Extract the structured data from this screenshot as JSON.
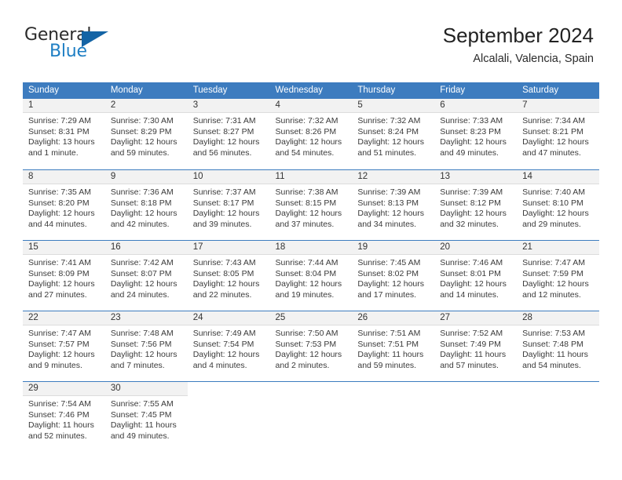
{
  "brand": {
    "name_top": "General",
    "name_bottom": "Blue",
    "accent_color": "#1464a5",
    "blue_text_color": "#1f7fc4"
  },
  "header": {
    "title": "September 2024",
    "location": "Alcalali, Valencia, Spain"
  },
  "calendar": {
    "header_bg": "#3d7cbf",
    "daynum_band_bg": "#f2f2f2",
    "weekdays": [
      "Sunday",
      "Monday",
      "Tuesday",
      "Wednesday",
      "Thursday",
      "Friday",
      "Saturday"
    ],
    "weeks": [
      [
        {
          "day": "1",
          "sunrise": "Sunrise: 7:29 AM",
          "sunset": "Sunset: 8:31 PM",
          "daylight_line1": "Daylight: 13 hours",
          "daylight_line2": "and 1 minute."
        },
        {
          "day": "2",
          "sunrise": "Sunrise: 7:30 AM",
          "sunset": "Sunset: 8:29 PM",
          "daylight_line1": "Daylight: 12 hours",
          "daylight_line2": "and 59 minutes."
        },
        {
          "day": "3",
          "sunrise": "Sunrise: 7:31 AM",
          "sunset": "Sunset: 8:27 PM",
          "daylight_line1": "Daylight: 12 hours",
          "daylight_line2": "and 56 minutes."
        },
        {
          "day": "4",
          "sunrise": "Sunrise: 7:32 AM",
          "sunset": "Sunset: 8:26 PM",
          "daylight_line1": "Daylight: 12 hours",
          "daylight_line2": "and 54 minutes."
        },
        {
          "day": "5",
          "sunrise": "Sunrise: 7:32 AM",
          "sunset": "Sunset: 8:24 PM",
          "daylight_line1": "Daylight: 12 hours",
          "daylight_line2": "and 51 minutes."
        },
        {
          "day": "6",
          "sunrise": "Sunrise: 7:33 AM",
          "sunset": "Sunset: 8:23 PM",
          "daylight_line1": "Daylight: 12 hours",
          "daylight_line2": "and 49 minutes."
        },
        {
          "day": "7",
          "sunrise": "Sunrise: 7:34 AM",
          "sunset": "Sunset: 8:21 PM",
          "daylight_line1": "Daylight: 12 hours",
          "daylight_line2": "and 47 minutes."
        }
      ],
      [
        {
          "day": "8",
          "sunrise": "Sunrise: 7:35 AM",
          "sunset": "Sunset: 8:20 PM",
          "daylight_line1": "Daylight: 12 hours",
          "daylight_line2": "and 44 minutes."
        },
        {
          "day": "9",
          "sunrise": "Sunrise: 7:36 AM",
          "sunset": "Sunset: 8:18 PM",
          "daylight_line1": "Daylight: 12 hours",
          "daylight_line2": "and 42 minutes."
        },
        {
          "day": "10",
          "sunrise": "Sunrise: 7:37 AM",
          "sunset": "Sunset: 8:17 PM",
          "daylight_line1": "Daylight: 12 hours",
          "daylight_line2": "and 39 minutes."
        },
        {
          "day": "11",
          "sunrise": "Sunrise: 7:38 AM",
          "sunset": "Sunset: 8:15 PM",
          "daylight_line1": "Daylight: 12 hours",
          "daylight_line2": "and 37 minutes."
        },
        {
          "day": "12",
          "sunrise": "Sunrise: 7:39 AM",
          "sunset": "Sunset: 8:13 PM",
          "daylight_line1": "Daylight: 12 hours",
          "daylight_line2": "and 34 minutes."
        },
        {
          "day": "13",
          "sunrise": "Sunrise: 7:39 AM",
          "sunset": "Sunset: 8:12 PM",
          "daylight_line1": "Daylight: 12 hours",
          "daylight_line2": "and 32 minutes."
        },
        {
          "day": "14",
          "sunrise": "Sunrise: 7:40 AM",
          "sunset": "Sunset: 8:10 PM",
          "daylight_line1": "Daylight: 12 hours",
          "daylight_line2": "and 29 minutes."
        }
      ],
      [
        {
          "day": "15",
          "sunrise": "Sunrise: 7:41 AM",
          "sunset": "Sunset: 8:09 PM",
          "daylight_line1": "Daylight: 12 hours",
          "daylight_line2": "and 27 minutes."
        },
        {
          "day": "16",
          "sunrise": "Sunrise: 7:42 AM",
          "sunset": "Sunset: 8:07 PM",
          "daylight_line1": "Daylight: 12 hours",
          "daylight_line2": "and 24 minutes."
        },
        {
          "day": "17",
          "sunrise": "Sunrise: 7:43 AM",
          "sunset": "Sunset: 8:05 PM",
          "daylight_line1": "Daylight: 12 hours",
          "daylight_line2": "and 22 minutes."
        },
        {
          "day": "18",
          "sunrise": "Sunrise: 7:44 AM",
          "sunset": "Sunset: 8:04 PM",
          "daylight_line1": "Daylight: 12 hours",
          "daylight_line2": "and 19 minutes."
        },
        {
          "day": "19",
          "sunrise": "Sunrise: 7:45 AM",
          "sunset": "Sunset: 8:02 PM",
          "daylight_line1": "Daylight: 12 hours",
          "daylight_line2": "and 17 minutes."
        },
        {
          "day": "20",
          "sunrise": "Sunrise: 7:46 AM",
          "sunset": "Sunset: 8:01 PM",
          "daylight_line1": "Daylight: 12 hours",
          "daylight_line2": "and 14 minutes."
        },
        {
          "day": "21",
          "sunrise": "Sunrise: 7:47 AM",
          "sunset": "Sunset: 7:59 PM",
          "daylight_line1": "Daylight: 12 hours",
          "daylight_line2": "and 12 minutes."
        }
      ],
      [
        {
          "day": "22",
          "sunrise": "Sunrise: 7:47 AM",
          "sunset": "Sunset: 7:57 PM",
          "daylight_line1": "Daylight: 12 hours",
          "daylight_line2": "and 9 minutes."
        },
        {
          "day": "23",
          "sunrise": "Sunrise: 7:48 AM",
          "sunset": "Sunset: 7:56 PM",
          "daylight_line1": "Daylight: 12 hours",
          "daylight_line2": "and 7 minutes."
        },
        {
          "day": "24",
          "sunrise": "Sunrise: 7:49 AM",
          "sunset": "Sunset: 7:54 PM",
          "daylight_line1": "Daylight: 12 hours",
          "daylight_line2": "and 4 minutes."
        },
        {
          "day": "25",
          "sunrise": "Sunrise: 7:50 AM",
          "sunset": "Sunset: 7:53 PM",
          "daylight_line1": "Daylight: 12 hours",
          "daylight_line2": "and 2 minutes."
        },
        {
          "day": "26",
          "sunrise": "Sunrise: 7:51 AM",
          "sunset": "Sunset: 7:51 PM",
          "daylight_line1": "Daylight: 11 hours",
          "daylight_line2": "and 59 minutes."
        },
        {
          "day": "27",
          "sunrise": "Sunrise: 7:52 AM",
          "sunset": "Sunset: 7:49 PM",
          "daylight_line1": "Daylight: 11 hours",
          "daylight_line2": "and 57 minutes."
        },
        {
          "day": "28",
          "sunrise": "Sunrise: 7:53 AM",
          "sunset": "Sunset: 7:48 PM",
          "daylight_line1": "Daylight: 11 hours",
          "daylight_line2": "and 54 minutes."
        }
      ],
      [
        {
          "day": "29",
          "sunrise": "Sunrise: 7:54 AM",
          "sunset": "Sunset: 7:46 PM",
          "daylight_line1": "Daylight: 11 hours",
          "daylight_line2": "and 52 minutes."
        },
        {
          "day": "30",
          "sunrise": "Sunrise: 7:55 AM",
          "sunset": "Sunset: 7:45 PM",
          "daylight_line1": "Daylight: 11 hours",
          "daylight_line2": "and 49 minutes."
        },
        {
          "day": "",
          "sunrise": "",
          "sunset": "",
          "daylight_line1": "",
          "daylight_line2": ""
        },
        {
          "day": "",
          "sunrise": "",
          "sunset": "",
          "daylight_line1": "",
          "daylight_line2": ""
        },
        {
          "day": "",
          "sunrise": "",
          "sunset": "",
          "daylight_line1": "",
          "daylight_line2": ""
        },
        {
          "day": "",
          "sunrise": "",
          "sunset": "",
          "daylight_line1": "",
          "daylight_line2": ""
        },
        {
          "day": "",
          "sunrise": "",
          "sunset": "",
          "daylight_line1": "",
          "daylight_line2": ""
        }
      ]
    ]
  }
}
